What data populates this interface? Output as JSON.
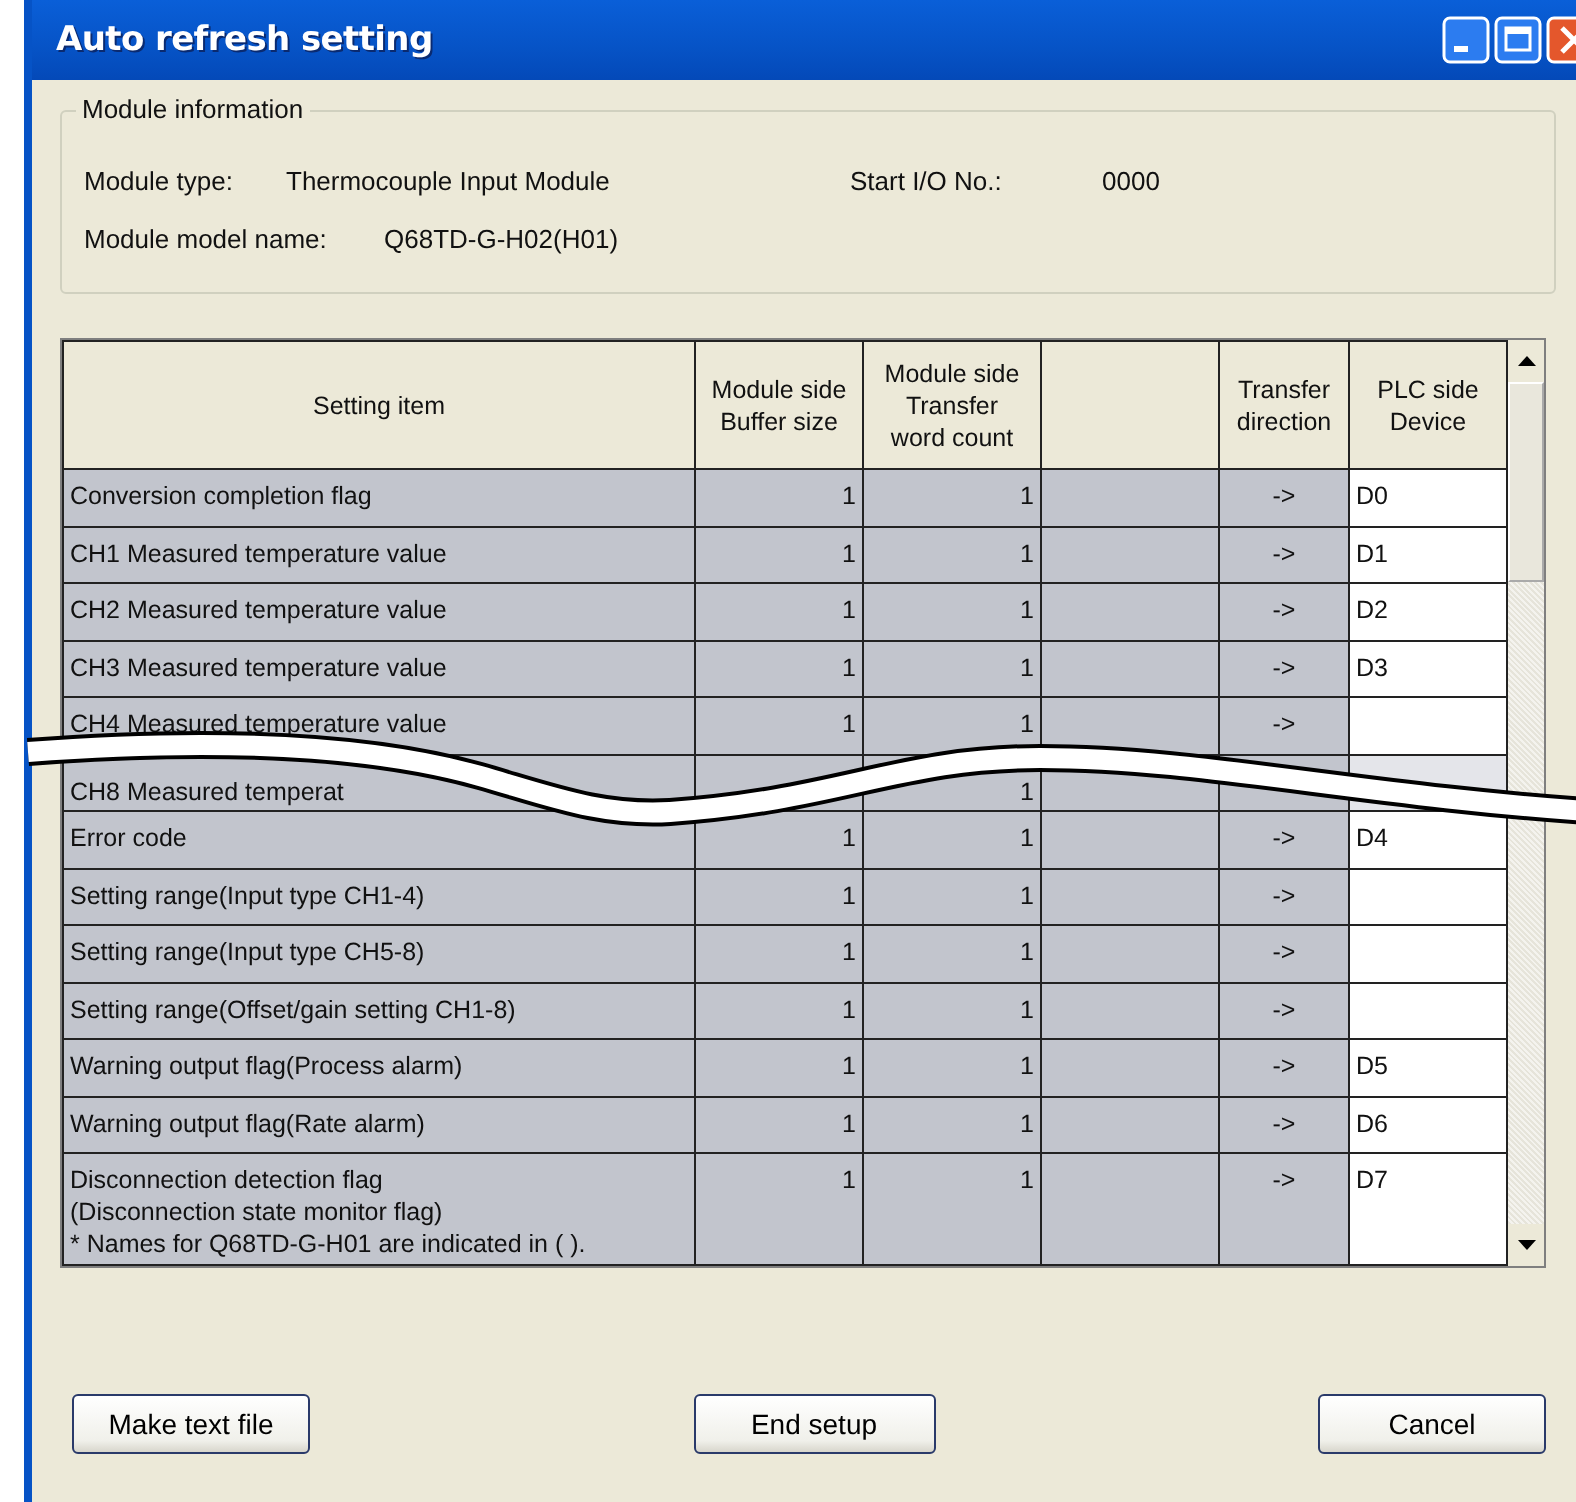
{
  "window": {
    "title": "Auto refresh setting"
  },
  "module_information": {
    "label": "Module information",
    "module_type": {
      "label": "Module type:",
      "value": "Thermocouple Input Module"
    },
    "start_io": {
      "label": "Start I/O No.:",
      "value": "0000"
    },
    "model_name": {
      "label": "Module model name:",
      "value": "Q68TD-G-H02(H01)"
    }
  },
  "table": {
    "columns": {
      "item": "Setting item",
      "buffer": "Module side\nBuffer size",
      "words": "Module side\nTransfer\nword count",
      "direction": "Transfer\ndirection",
      "device": "PLC side\nDevice"
    },
    "rows": [
      {
        "item": "Conversion completion flag",
        "buffer": "1",
        "words": "1",
        "direction": "->",
        "device": "D0"
      },
      {
        "item": "CH1 Measured temperature value",
        "buffer": "1",
        "words": "1",
        "direction": "->",
        "device": "D1"
      },
      {
        "item": "CH2 Measured temperature value",
        "buffer": "1",
        "words": "1",
        "direction": "->",
        "device": "D2"
      },
      {
        "item": "CH3 Measured temperature value",
        "buffer": "1",
        "words": "1",
        "direction": "->",
        "device": "D3"
      },
      {
        "item": "CH4 Measured temperature value",
        "buffer": "1",
        "words": "1",
        "direction": "->"
      },
      {
        "item": "CH8 Measured temperat",
        "words": "1"
      },
      {
        "item": "Error code",
        "buffer": "1",
        "words": "1",
        "direction": "->",
        "device": "D4"
      },
      {
        "item": "Setting range(Input type CH1-4)",
        "buffer": "1",
        "words": "1",
        "direction": "->"
      },
      {
        "item": "Setting range(Input type CH5-8)",
        "buffer": "1",
        "words": "1",
        "direction": "->"
      },
      {
        "item": "Setting range(Offset/gain setting CH1-8)",
        "buffer": "1",
        "words": "1",
        "direction": "->"
      },
      {
        "item": "Warning output flag(Process alarm)",
        "buffer": "1",
        "words": "1",
        "direction": "->",
        "device": "D5"
      },
      {
        "item": "Warning output flag(Rate alarm)",
        "buffer": "1",
        "words": "1",
        "direction": "->",
        "device": "D6"
      },
      {
        "item": "Disconnection detection flag\n(Disconnection state monitor flag)\n* Names for Q68TD-G-H01 are indicated in ( ).",
        "buffer": "1",
        "words": "1",
        "direction": "->",
        "device": "D7"
      }
    ]
  },
  "buttons": [
    {
      "label": "Make text file"
    },
    {
      "label": "End setup"
    },
    {
      "label": "Cancel"
    }
  ]
}
